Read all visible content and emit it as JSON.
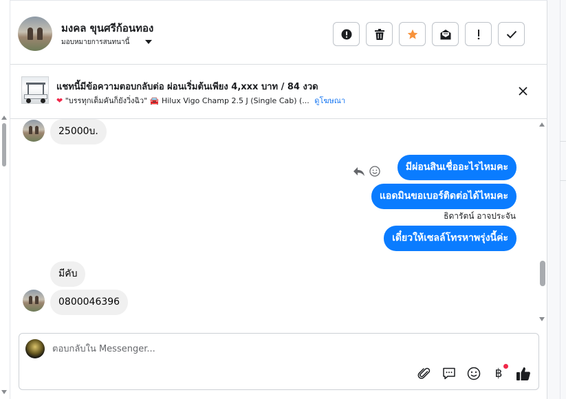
{
  "header": {
    "contact_name": "มงคล ขุนศรีก้อนทอง",
    "assign_label": "มอบหมายการสนทนานี้",
    "actions": [
      {
        "name": "report-spam",
        "icon": "exclamation-circle-icon"
      },
      {
        "name": "delete",
        "icon": "trash-icon"
      },
      {
        "name": "star",
        "icon": "star-icon",
        "color": "#f7923b"
      },
      {
        "name": "mark-unread",
        "icon": "mail-icon"
      },
      {
        "name": "flag",
        "icon": "exclamation-icon"
      },
      {
        "name": "mark-done",
        "icon": "check-icon"
      }
    ]
  },
  "ad_banner": {
    "title": "แชทนี้มีข้อความตอบกลับต่อ ผ่อนเริ่มต้นเพียง 4,xxx บาท / 84 งวด",
    "quote": "\"บรรทุกเต็มคันก็ยังวิ่งฉิว\"",
    "vehicle": "Hilux Vigo Champ 2.5 J (Single Cab) (...",
    "link_label": "ดูโฆษณา",
    "heart_icon": "heart-icon",
    "car_icon": "car-icon"
  },
  "messages": [
    {
      "direction": "in",
      "text": "25000บ."
    },
    {
      "direction": "out",
      "text": "มีผ่อนสินเชื่ออะไรไหมคะ"
    },
    {
      "direction": "out",
      "text": "แอดมินขอเบอร์ติดต่อได้ไหมคะ"
    },
    {
      "direction": "out_sender",
      "text": "ธิดารัตน์ อาจประจัน"
    },
    {
      "direction": "out",
      "text": "เดี๋ยวให้เซลล์โทรหาพรุ่งนี้ค่ะ"
    },
    {
      "direction": "in",
      "text": "มีคับ"
    },
    {
      "direction": "in",
      "text": "0800046396"
    }
  ],
  "composer": {
    "placeholder": "ตอบกลับใน Messenger...",
    "tools": [
      "paperclip-icon",
      "saved-reply-icon",
      "emoji-icon",
      "baht-icon",
      "thumbs-up-icon"
    ],
    "baht_symbol": "฿"
  },
  "colors": {
    "accent": "#0a7cff",
    "star": "#f7923b",
    "notification_dot": "#f02849"
  }
}
